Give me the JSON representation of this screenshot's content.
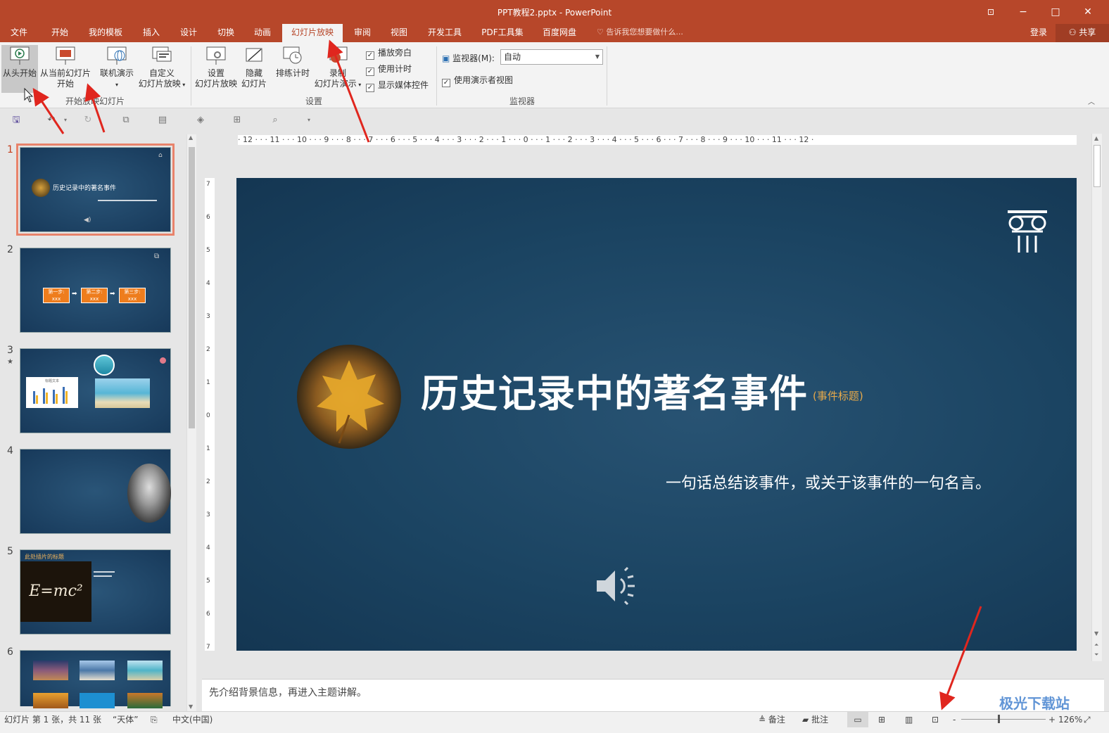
{
  "window": {
    "title": "PPT教程2.pptx - PowerPoint"
  },
  "tabs": [
    "文件",
    "开始",
    "我的模板",
    "插入",
    "设计",
    "切换",
    "动画",
    "幻灯片放映",
    "审阅",
    "视图",
    "开发工具",
    "PDF工具集",
    "百度网盘"
  ],
  "active_tab": "幻灯片放映",
  "tell_me": "告诉我您想要做什么...",
  "account": {
    "login": "登录",
    "share": "共享"
  },
  "ribbon": {
    "from_beginning": "从头开始",
    "from_current_l1": "从当前幻灯片",
    "from_current_l2": "开始",
    "online_present": "联机演示",
    "custom_show_l1": "自定义",
    "custom_show_l2": "幻灯片放映",
    "group_start": "开始放映幻灯片",
    "setup_l1": "设置",
    "setup_l2": "幻灯片放映",
    "hide_l1": "隐藏",
    "hide_l2": "幻灯片",
    "rehearse": "排练计时",
    "record_l1": "录制",
    "record_l2": "幻灯片演示",
    "chk_narration": "播放旁白",
    "chk_timings": "使用计时",
    "chk_media": "显示媒体控件",
    "group_setup": "设置",
    "monitor_label": "监视器(M):",
    "monitor_value": "自动",
    "presenter_view": "使用演示者视图",
    "group_monitors": "监视器"
  },
  "ruler_h": "· 12 · · · 11 · · · 10 · · · 9 · · · 8 · · · 7 · · · 6 · · · 5 · · · 4 · · · 3 · · · 2 · · · 1 · · · 0 · · · 1 · · · 2 · · · 3 · · · 4 · · · 5 · · · 6 · · · 7 · · · 8 · · · 9 · · · 10 · · · 11 · · · 12 ·",
  "slides": [
    {
      "num": "1",
      "title": "历史记录中的著名事件",
      "tag": "(事件标题)",
      "sub": "一句话总结该事件，或关于该事件的一句名言。"
    },
    {
      "num": "2",
      "steps": [
        "第一步:",
        "第二步:",
        "第三步:"
      ],
      "step_sub": "xxx"
    },
    {
      "num": "3",
      "chart_title": "标题文本"
    },
    {
      "num": "4"
    },
    {
      "num": "5",
      "title": "此处插片的标题",
      "formula": "E=mc²"
    },
    {
      "num": "6"
    }
  ],
  "notes": "先介绍背景信息，再进入主题讲解。",
  "status": {
    "slide_info": "幻灯片 第 1 张，共 11 张",
    "theme": "“天体”",
    "language": "中文(中国)",
    "notes_btn": "备注",
    "comments_btn": "批注",
    "zoom_minus": "-",
    "zoom_plus": "+",
    "zoom": "126%"
  },
  "watermark": "极光下载站"
}
